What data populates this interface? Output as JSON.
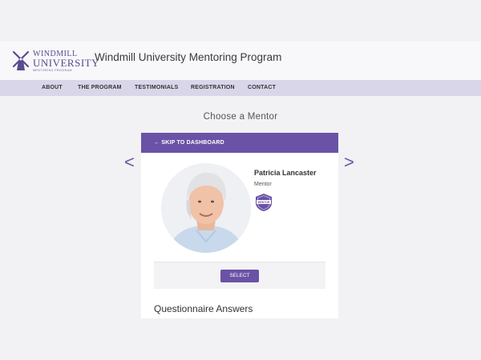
{
  "header": {
    "logo": {
      "line1": "WINDMILL",
      "line2": "UNIVERSITY",
      "line3": "MENTORING PROGRAM"
    },
    "title": "Windmill University Mentoring Program"
  },
  "nav": {
    "items": [
      {
        "label": "ABOUT"
      },
      {
        "label": "THE PROGRAM"
      },
      {
        "label": "TESTIMONIALS"
      },
      {
        "label": "REGISTRATION"
      },
      {
        "label": "CONTACT"
      }
    ]
  },
  "main": {
    "title": "Choose a Mentor",
    "prev_arrow": "<",
    "next_arrow": ">"
  },
  "card": {
    "skip_label": "← SKIP TO DASHBOARD",
    "mentor": {
      "name": "Patricia Lancaster",
      "role": "Mentor",
      "badge_text": "MENTOR"
    },
    "select_label": "SELECT",
    "questionnaire_title": "Questionnaire Answers"
  },
  "colors": {
    "accent": "#6a52a6",
    "nav_bg": "#d9d6ea",
    "logo": "#5a4a8e"
  }
}
